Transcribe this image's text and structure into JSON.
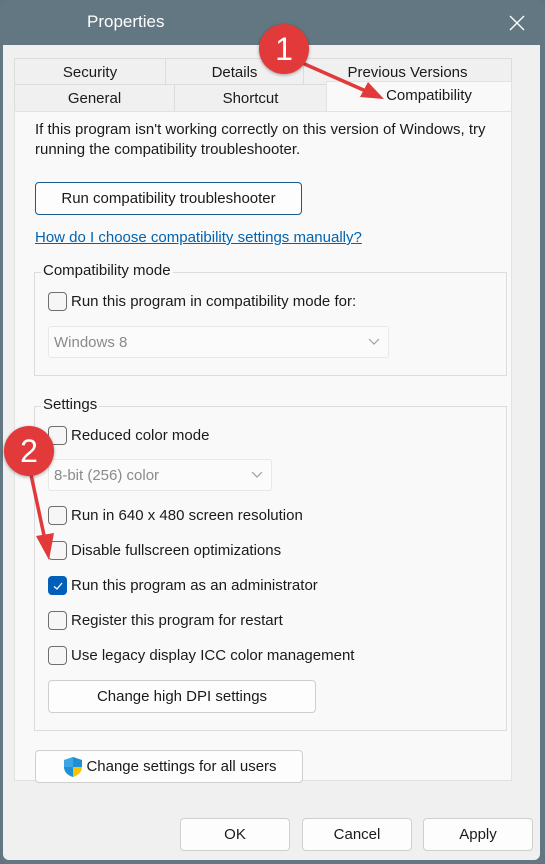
{
  "window": {
    "title": "Properties",
    "close_icon": "close-icon"
  },
  "tabs": {
    "row_back": [
      {
        "label": "Security"
      },
      {
        "label": "Details"
      },
      {
        "label": "Previous Versions"
      }
    ],
    "row_front": [
      {
        "label": "General"
      },
      {
        "label": "Shortcut"
      },
      {
        "label": "Compatibility",
        "active": true
      }
    ]
  },
  "compatibility": {
    "intro": "If this program isn't working correctly on this version of Windows, try running the compatibility troubleshooter.",
    "troubleshooter_button": "Run compatibility troubleshooter",
    "help_link": "How do I choose compatibility settings manually?",
    "mode_group": {
      "label": "Compatibility mode",
      "checkbox_label": "Run this program in compatibility mode for:",
      "checked": false,
      "select_value": "Windows 8"
    },
    "settings_group": {
      "label": "Settings",
      "reduced_color": {
        "label": "Reduced color mode",
        "checked": false
      },
      "color_select_value": "8-bit (256) color",
      "options": [
        {
          "label": "Run in 640 x 480 screen resolution",
          "checked": false
        },
        {
          "label": "Disable fullscreen optimizations",
          "checked": false
        },
        {
          "label": "Run this program as an administrator",
          "checked": true
        },
        {
          "label": "Register this program for restart",
          "checked": false
        },
        {
          "label": "Use legacy display ICC color management",
          "checked": false
        }
      ],
      "dpi_button": "Change high DPI settings"
    },
    "all_users_button": "Change settings for all users",
    "all_users_icon": "uac-shield-icon"
  },
  "footer": {
    "ok": "OK",
    "cancel": "Cancel",
    "apply": "Apply"
  },
  "annotations": {
    "badge_1": "1",
    "badge_2": "2",
    "color": "#e2393a"
  }
}
